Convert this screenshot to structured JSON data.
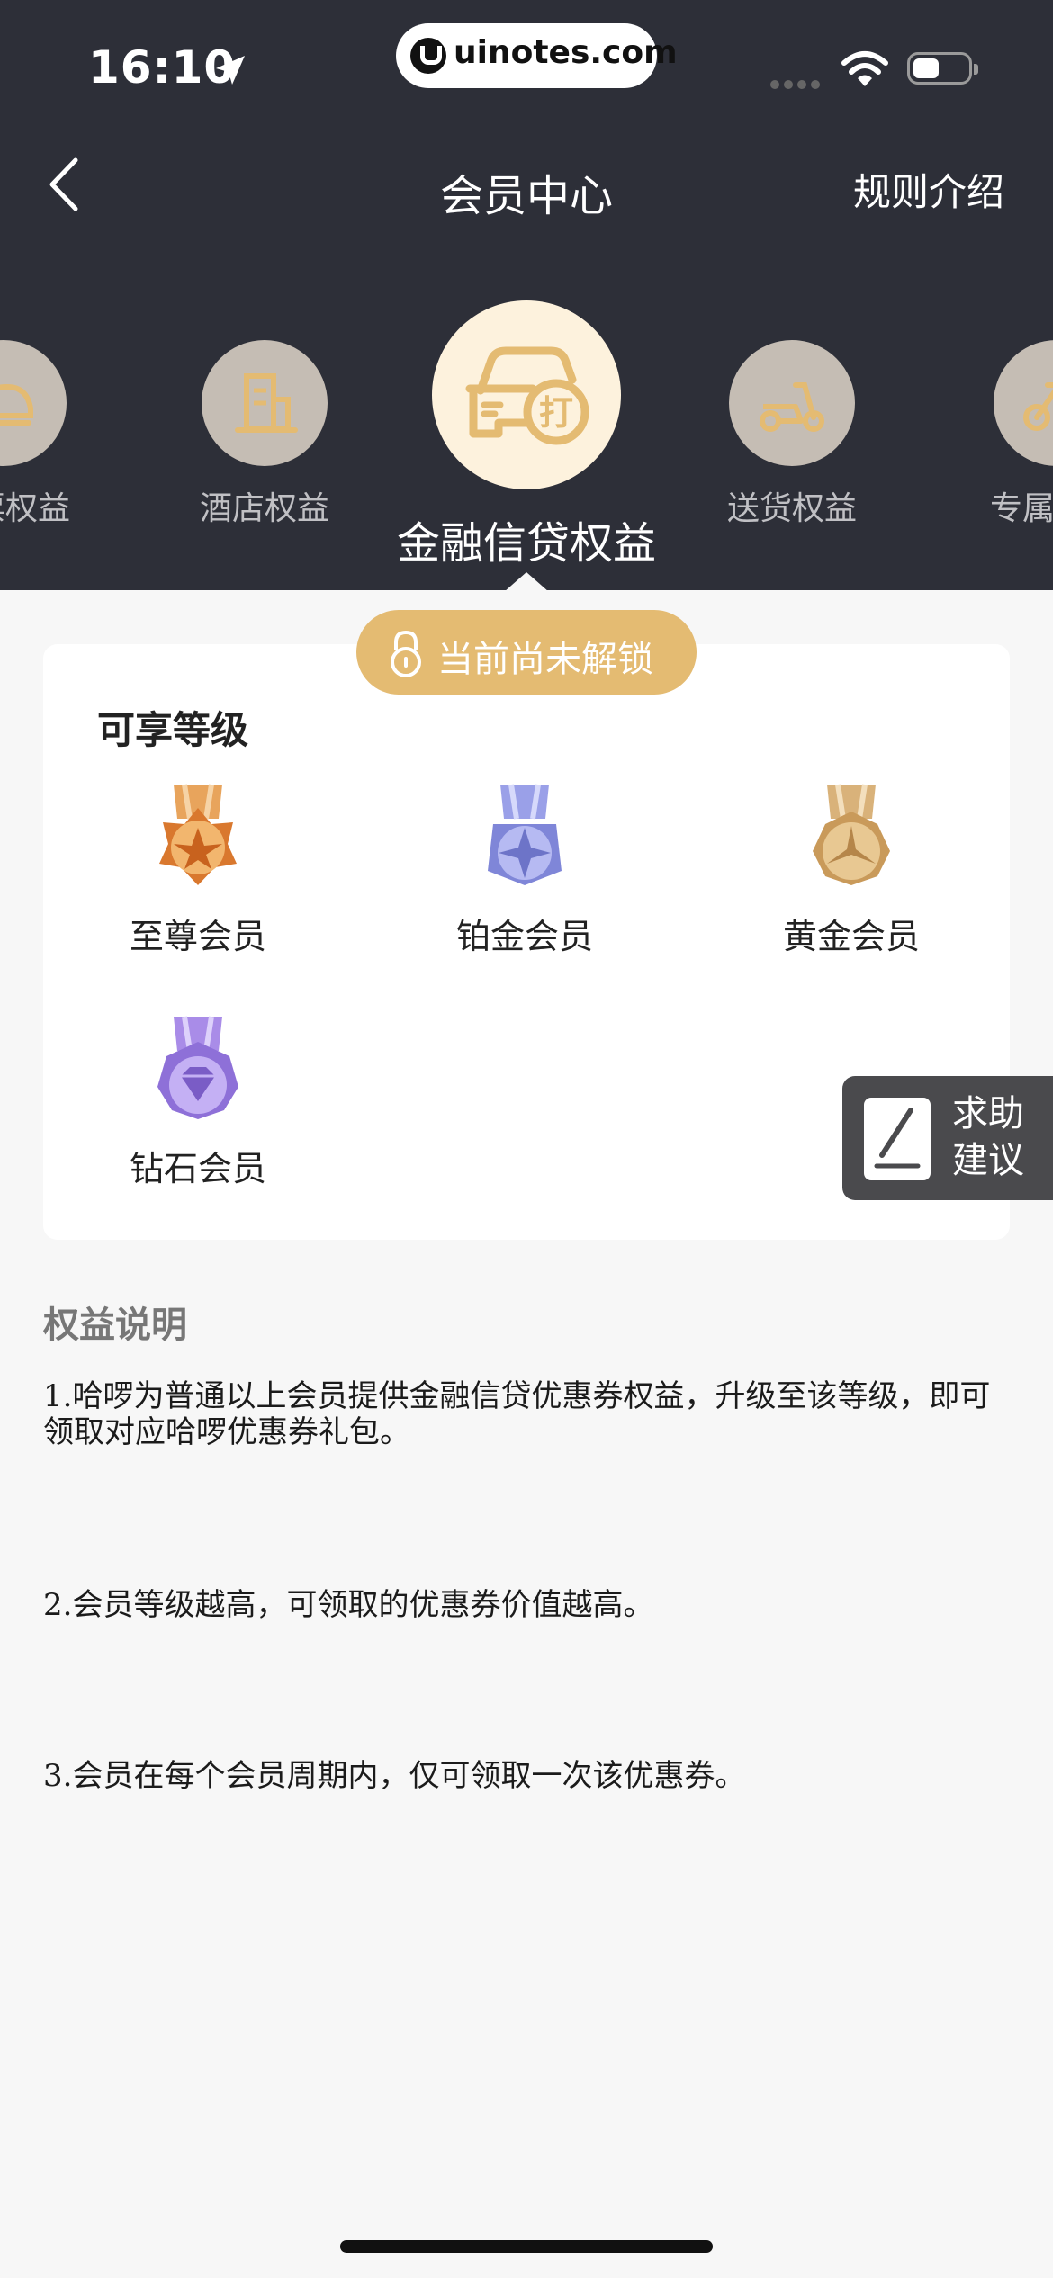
{
  "status_bar": {
    "time": "16:10",
    "url": "uinotes.com"
  },
  "nav": {
    "title": "会员中心",
    "right_link": "规则介绍"
  },
  "benefits": [
    {
      "label": "票权益",
      "icon": "train-icon"
    },
    {
      "label": "酒店权益",
      "icon": "hotel-icon"
    },
    {
      "label": "金融信贷权益",
      "icon": "car-discount-icon",
      "active": true
    },
    {
      "label": "送货权益",
      "icon": "scooter-icon"
    },
    {
      "label": "专属",
      "icon": "bike-icon"
    }
  ],
  "lock_status": "当前尚未解锁",
  "levels": {
    "title": "可享等级",
    "items": [
      {
        "label": "至尊会员",
        "color": "#e59a4a"
      },
      {
        "label": "铂金会员",
        "color": "#9aa0e8"
      },
      {
        "label": "黄金会员",
        "color": "#d9b27a"
      },
      {
        "label": "钻石会员",
        "color": "#a98ce8"
      }
    ]
  },
  "help": {
    "line1": "求助",
    "line2": "建议"
  },
  "description": {
    "title": "权益说明",
    "paragraphs": [
      "1.哈啰为普通以上会员提供金融信贷优惠券权益，升级至该等级，即可领取对应哈啰优惠券礼包。",
      "2.会员等级越高，可领取的优惠券价值越高。",
      "3.会员在每个会员周期内，仅可领取一次该优惠券。"
    ]
  },
  "colors": {
    "header_bg": "#2d2f38",
    "accent_gold": "#e4bb72",
    "page_bg": "#f7f7f7"
  }
}
